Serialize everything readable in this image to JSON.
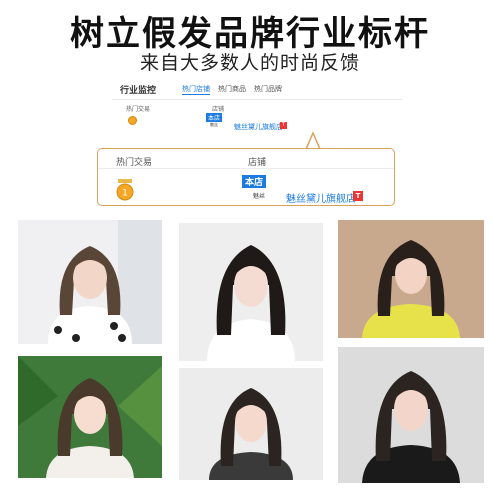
{
  "headline": "树立假发品牌行业标杆",
  "subline": "来自大多数人的时尚反馈",
  "monitor": {
    "title": "行业监控",
    "tabs": [
      "热门店铺",
      "热门商品",
      "热门品牌"
    ],
    "active_tab": 0,
    "col_trade": "热门交易",
    "col_store": "店铺",
    "badge": "本店",
    "logo_text": "魅丝",
    "store_name": "魅丝黛儿旗舰店",
    "tag": "T"
  },
  "callout": {
    "col_trade": "热门交易",
    "col_store": "店铺",
    "badge": "本店",
    "logo_text": "魅丝",
    "store_name": "魅丝黛儿旗舰店",
    "tag": "T"
  },
  "photos": [
    {
      "name": "photo-model-1",
      "background": "#f0f0f2",
      "hair": "#5a4636",
      "top": "#ffffff"
    },
    {
      "name": "photo-model-2",
      "background": "#eeeeee",
      "hair": "#1f1a18",
      "top": "#ffffff"
    },
    {
      "name": "photo-model-3",
      "background": "#c9a98e",
      "hair": "#2a201b",
      "top": "#e8e24a"
    },
    {
      "name": "photo-model-4",
      "background": "#3f7a3a",
      "hair": "#4a3a2c",
      "top": "#f3f0ec"
    },
    {
      "name": "photo-model-5",
      "background": "#ececec",
      "hair": "#2b2420",
      "top": "#3a3a3a"
    },
    {
      "name": "photo-model-6",
      "background": "#dcdcdc",
      "hair": "#2c2420",
      "top": "#1a1a1a"
    }
  ],
  "colors": {
    "accent": "#1c7be0",
    "callout_border": "#d9a25a",
    "medal": "#f5a623",
    "tag": "#e33333"
  }
}
